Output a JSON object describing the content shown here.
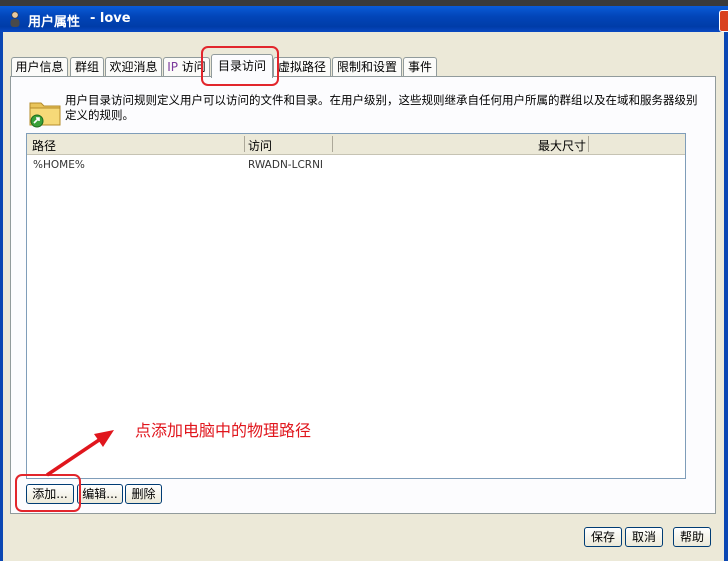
{
  "window": {
    "title": "用户属性",
    "subtitle": "- love"
  },
  "tabs": [
    {
      "label": "用户信息"
    },
    {
      "label": "群组"
    },
    {
      "label": "欢迎消息"
    },
    {
      "label_ip": "IP",
      "label_rest": " 访问"
    },
    {
      "label": "目录访问"
    },
    {
      "label": "虚拟路径"
    },
    {
      "label": "限制和设置"
    },
    {
      "label": "事件"
    }
  ],
  "description": "用户目录访问规则定义用户可以访问的文件和目录。在用户级别，这些规则继承自任何用户所属的群组以及在域和服务器级别定义的规则。",
  "list": {
    "columns": [
      "路径",
      "访问",
      "最大尺寸"
    ],
    "rows": [
      {
        "path": "%HOME%",
        "access": "RWADN-LCRNI",
        "max_size": ""
      }
    ]
  },
  "buttons": {
    "add": "添加...",
    "edit": "编辑...",
    "delete": "删除",
    "save": "保存",
    "cancel": "取消",
    "help": "帮助"
  },
  "annotation": {
    "text": "点添加电脑中的物理路径",
    "color": "#e0161d"
  }
}
